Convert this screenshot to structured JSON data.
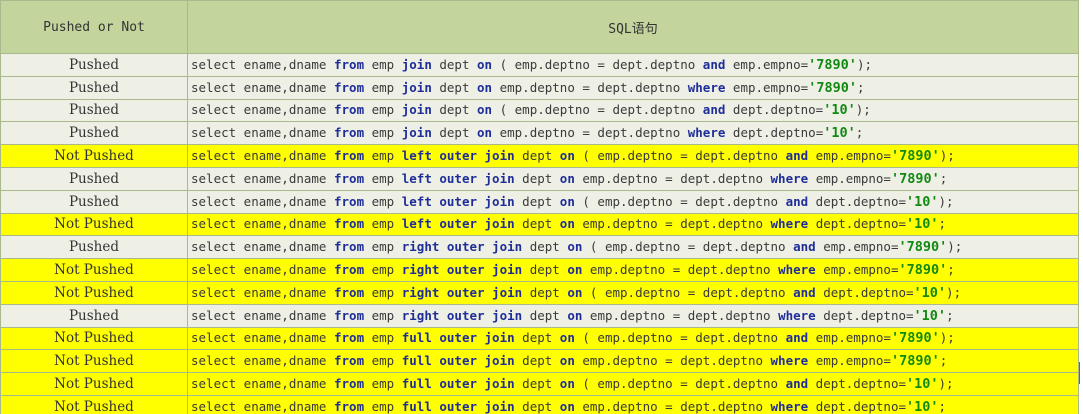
{
  "table": {
    "headers": [
      "Pushed or Not",
      "SQL语句"
    ],
    "colors": {
      "header_bg": "#c3d59d",
      "row_bg": "#eef0e6",
      "not_pushed_bg": "#ffff00",
      "keyword": "#1f2d99",
      "literal": "#128a12"
    },
    "rows": [
      {
        "status": "Pushed",
        "sql": [
          [
            "t",
            "select ename,dname "
          ],
          [
            "k",
            "from"
          ],
          [
            "t",
            " emp "
          ],
          [
            "k",
            "join"
          ],
          [
            "t",
            " dept "
          ],
          [
            "k",
            "on"
          ],
          [
            "t",
            " ( emp.deptno = dept.deptno "
          ],
          [
            "k",
            "and"
          ],
          [
            "t",
            " emp.empno="
          ],
          [
            "l",
            "'7890'"
          ],
          [
            "t",
            ");"
          ]
        ]
      },
      {
        "status": "Pushed",
        "sql": [
          [
            "t",
            "select ename,dname "
          ],
          [
            "k",
            "from"
          ],
          [
            "t",
            " emp "
          ],
          [
            "k",
            "join"
          ],
          [
            "t",
            " dept "
          ],
          [
            "k",
            "on"
          ],
          [
            "t",
            " emp.deptno = dept.deptno "
          ],
          [
            "k",
            "where"
          ],
          [
            "t",
            " emp.empno="
          ],
          [
            "l",
            "'7890'"
          ],
          [
            "t",
            ";"
          ]
        ]
      },
      {
        "status": "Pushed",
        "sql": [
          [
            "t",
            "select ename,dname "
          ],
          [
            "k",
            "from"
          ],
          [
            "t",
            " emp "
          ],
          [
            "k",
            "join"
          ],
          [
            "t",
            " dept "
          ],
          [
            "k",
            "on"
          ],
          [
            "t",
            " ( emp.deptno = dept.deptno "
          ],
          [
            "k",
            "and"
          ],
          [
            "t",
            " dept.deptno="
          ],
          [
            "l",
            "'10'"
          ],
          [
            "t",
            ");"
          ]
        ]
      },
      {
        "status": "Pushed",
        "sql": [
          [
            "t",
            "select ename,dname "
          ],
          [
            "k",
            "from"
          ],
          [
            "t",
            " emp "
          ],
          [
            "k",
            "join"
          ],
          [
            "t",
            " dept "
          ],
          [
            "k",
            "on"
          ],
          [
            "t",
            " emp.deptno = dept.deptno "
          ],
          [
            "k",
            "where"
          ],
          [
            "t",
            " dept.deptno="
          ],
          [
            "l",
            "'10'"
          ],
          [
            "t",
            ";"
          ]
        ]
      },
      {
        "status": "Not Pushed",
        "sql": [
          [
            "t",
            "select ename,dname "
          ],
          [
            "k",
            "from"
          ],
          [
            "t",
            " emp "
          ],
          [
            "k",
            "left outer join"
          ],
          [
            "t",
            " dept "
          ],
          [
            "k",
            "on"
          ],
          [
            "t",
            " ( emp.deptno = dept.deptno "
          ],
          [
            "k",
            "and"
          ],
          [
            "t",
            " emp.empno="
          ],
          [
            "l",
            "'7890'"
          ],
          [
            "t",
            ");"
          ]
        ]
      },
      {
        "status": "Pushed",
        "sql": [
          [
            "t",
            "select ename,dname "
          ],
          [
            "k",
            "from"
          ],
          [
            "t",
            " emp "
          ],
          [
            "k",
            "left outer join"
          ],
          [
            "t",
            " dept "
          ],
          [
            "k",
            "on"
          ],
          [
            "t",
            " emp.deptno = dept.deptno "
          ],
          [
            "k",
            "where"
          ],
          [
            "t",
            " emp.empno="
          ],
          [
            "l",
            "'7890'"
          ],
          [
            "t",
            ";"
          ]
        ]
      },
      {
        "status": "Pushed",
        "sql": [
          [
            "t",
            "select ename,dname "
          ],
          [
            "k",
            "from"
          ],
          [
            "t",
            " emp "
          ],
          [
            "k",
            "left outer join"
          ],
          [
            "t",
            " dept "
          ],
          [
            "k",
            "on"
          ],
          [
            "t",
            " ( emp.deptno = dept.deptno "
          ],
          [
            "k",
            "and"
          ],
          [
            "t",
            " dept.deptno="
          ],
          [
            "l",
            "'10'"
          ],
          [
            "t",
            ");"
          ]
        ]
      },
      {
        "status": "Not Pushed",
        "sql": [
          [
            "t",
            "select ename,dname "
          ],
          [
            "k",
            "from"
          ],
          [
            "t",
            " emp "
          ],
          [
            "k",
            "left outer join"
          ],
          [
            "t",
            " dept "
          ],
          [
            "k",
            "on"
          ],
          [
            "t",
            " emp.deptno = dept.deptno "
          ],
          [
            "k",
            "where"
          ],
          [
            "t",
            " dept.deptno="
          ],
          [
            "l",
            "'10'"
          ],
          [
            "t",
            ";"
          ]
        ]
      },
      {
        "status": "Pushed",
        "sql": [
          [
            "t",
            "select ename,dname "
          ],
          [
            "k",
            "from"
          ],
          [
            "t",
            " emp "
          ],
          [
            "k",
            "right outer join"
          ],
          [
            "t",
            " dept "
          ],
          [
            "k",
            "on"
          ],
          [
            "t",
            " ( emp.deptno = dept.deptno "
          ],
          [
            "k",
            "and"
          ],
          [
            "t",
            " emp.empno="
          ],
          [
            "l",
            "'7890'"
          ],
          [
            "t",
            ");"
          ]
        ]
      },
      {
        "status": "Not Pushed",
        "sql": [
          [
            "t",
            "select ename,dname "
          ],
          [
            "k",
            "from"
          ],
          [
            "t",
            " emp "
          ],
          [
            "k",
            "right outer join"
          ],
          [
            "t",
            " dept "
          ],
          [
            "k",
            "on"
          ],
          [
            "t",
            " emp.deptno = dept.deptno "
          ],
          [
            "k",
            "where"
          ],
          [
            "t",
            " emp.empno="
          ],
          [
            "l",
            "'7890'"
          ],
          [
            "t",
            ";"
          ]
        ]
      },
      {
        "status": "Not Pushed",
        "sql": [
          [
            "t",
            "select ename,dname "
          ],
          [
            "k",
            "from"
          ],
          [
            "t",
            " emp "
          ],
          [
            "k",
            "right outer join"
          ],
          [
            "t",
            " dept "
          ],
          [
            "k",
            "on"
          ],
          [
            "t",
            " ( emp.deptno = dept.deptno "
          ],
          [
            "k",
            "and"
          ],
          [
            "t",
            " dept.deptno="
          ],
          [
            "l",
            "'10'"
          ],
          [
            "t",
            ");"
          ]
        ]
      },
      {
        "status": "Pushed",
        "sql": [
          [
            "t",
            "select ename,dname "
          ],
          [
            "k",
            "from"
          ],
          [
            "t",
            " emp "
          ],
          [
            "k",
            "right outer join"
          ],
          [
            "t",
            " dept "
          ],
          [
            "k",
            "on"
          ],
          [
            "t",
            " emp.deptno = dept.deptno "
          ],
          [
            "k",
            "where"
          ],
          [
            "t",
            " dept.deptno="
          ],
          [
            "l",
            "'10'"
          ],
          [
            "t",
            ";"
          ]
        ]
      },
      {
        "status": "Not Pushed",
        "sql": [
          [
            "t",
            "select ename,dname "
          ],
          [
            "k",
            "from"
          ],
          [
            "t",
            " emp "
          ],
          [
            "k",
            "full outer join"
          ],
          [
            "t",
            " dept "
          ],
          [
            "k",
            "on"
          ],
          [
            "t",
            " ( emp.deptno = dept.deptno "
          ],
          [
            "k",
            "and"
          ],
          [
            "t",
            " emp.empno="
          ],
          [
            "l",
            "'7890'"
          ],
          [
            "t",
            ");"
          ]
        ]
      },
      {
        "status": "Not Pushed",
        "sql": [
          [
            "t",
            "select ename,dname "
          ],
          [
            "k",
            "from"
          ],
          [
            "t",
            " emp "
          ],
          [
            "k",
            "full outer join"
          ],
          [
            "t",
            " dept "
          ],
          [
            "k",
            "on"
          ],
          [
            "t",
            " emp.deptno = dept.deptno "
          ],
          [
            "k",
            "where"
          ],
          [
            "t",
            " emp.empno="
          ],
          [
            "l",
            "'7890'"
          ],
          [
            "t",
            ";"
          ]
        ]
      },
      {
        "status": "Not Pushed",
        "sql": [
          [
            "t",
            "select ename,dname "
          ],
          [
            "k",
            "from"
          ],
          [
            "t",
            " emp "
          ],
          [
            "k",
            "full outer join"
          ],
          [
            "t",
            " dept "
          ],
          [
            "k",
            "on"
          ],
          [
            "t",
            " ( emp.deptno = dept.deptno "
          ],
          [
            "k",
            "and"
          ],
          [
            "t",
            " dept.deptno="
          ],
          [
            "l",
            "'10'"
          ],
          [
            "t",
            ");"
          ]
        ]
      },
      {
        "status": "Not Pushed",
        "sql": [
          [
            "t",
            "select ename,dname "
          ],
          [
            "k",
            "from"
          ],
          [
            "t",
            " emp "
          ],
          [
            "k",
            "full outer join"
          ],
          [
            "t",
            " dept "
          ],
          [
            "k",
            "on"
          ],
          [
            "t",
            " emp.deptno = dept.deptno "
          ],
          [
            "k",
            "where"
          ],
          [
            "t",
            " dept.deptno="
          ],
          [
            "l",
            "'10'"
          ],
          [
            "t",
            ";"
          ]
        ]
      }
    ]
  }
}
